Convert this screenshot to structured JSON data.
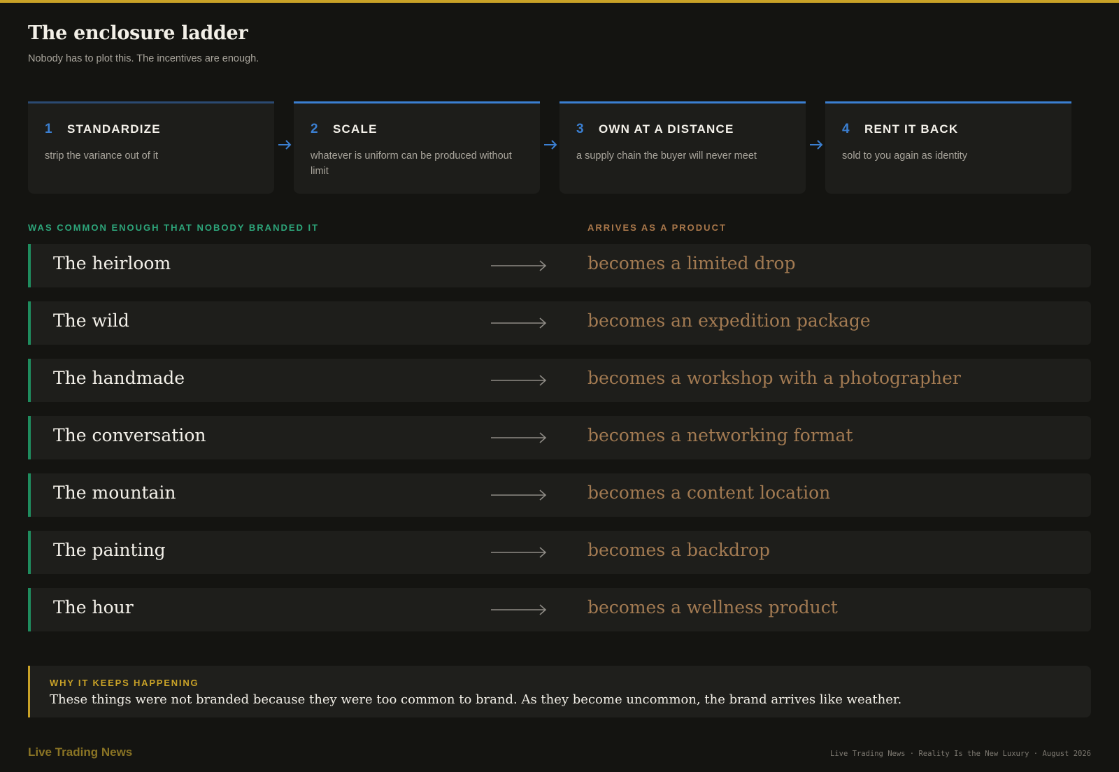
{
  "header": {
    "title": "The enclosure ladder",
    "subtitle": "Nobody has to plot this. The incentives are enough."
  },
  "steps": [
    {
      "num": "1",
      "title": "STANDARDIZE",
      "desc": "strip the variance out of it"
    },
    {
      "num": "2",
      "title": "SCALE",
      "desc": "whatever is uniform can be produced without limit"
    },
    {
      "num": "3",
      "title": "OWN AT A DISTANCE",
      "desc": "a supply chain the buyer will never meet"
    },
    {
      "num": "4",
      "title": "RENT IT BACK",
      "desc": "sold to you again as identity"
    }
  ],
  "columns": {
    "left": "WAS COMMON ENOUGH THAT NOBODY BRANDED IT",
    "right": "ARRIVES AS A PRODUCT"
  },
  "rows": [
    {
      "from": "The heirloom",
      "to": "becomes a limited drop"
    },
    {
      "from": "The wild",
      "to": "becomes an expedition package"
    },
    {
      "from": "The handmade",
      "to": "becomes a workshop with a photographer"
    },
    {
      "from": "The conversation",
      "to": "becomes a networking format"
    },
    {
      "from": "The mountain",
      "to": "becomes a content location"
    },
    {
      "from": "The painting",
      "to": "becomes a backdrop"
    },
    {
      "from": "The hour",
      "to": "becomes a wellness product"
    }
  ],
  "callout": {
    "label": "WHY IT KEEPS HAPPENING",
    "text": "These things were not branded because they were too common to brand. As they become uncommon, the brand arrives like weather."
  },
  "footer": {
    "brand": "Live Trading News",
    "meta": "Live Trading News · Reality Is the New Luxury · August 2026"
  },
  "colors": {
    "accent_gold": "#c9a227",
    "step_blue": "#3b7fd1",
    "common_green": "#2da57a",
    "product_brown": "#a27a52",
    "background": "#141411"
  }
}
